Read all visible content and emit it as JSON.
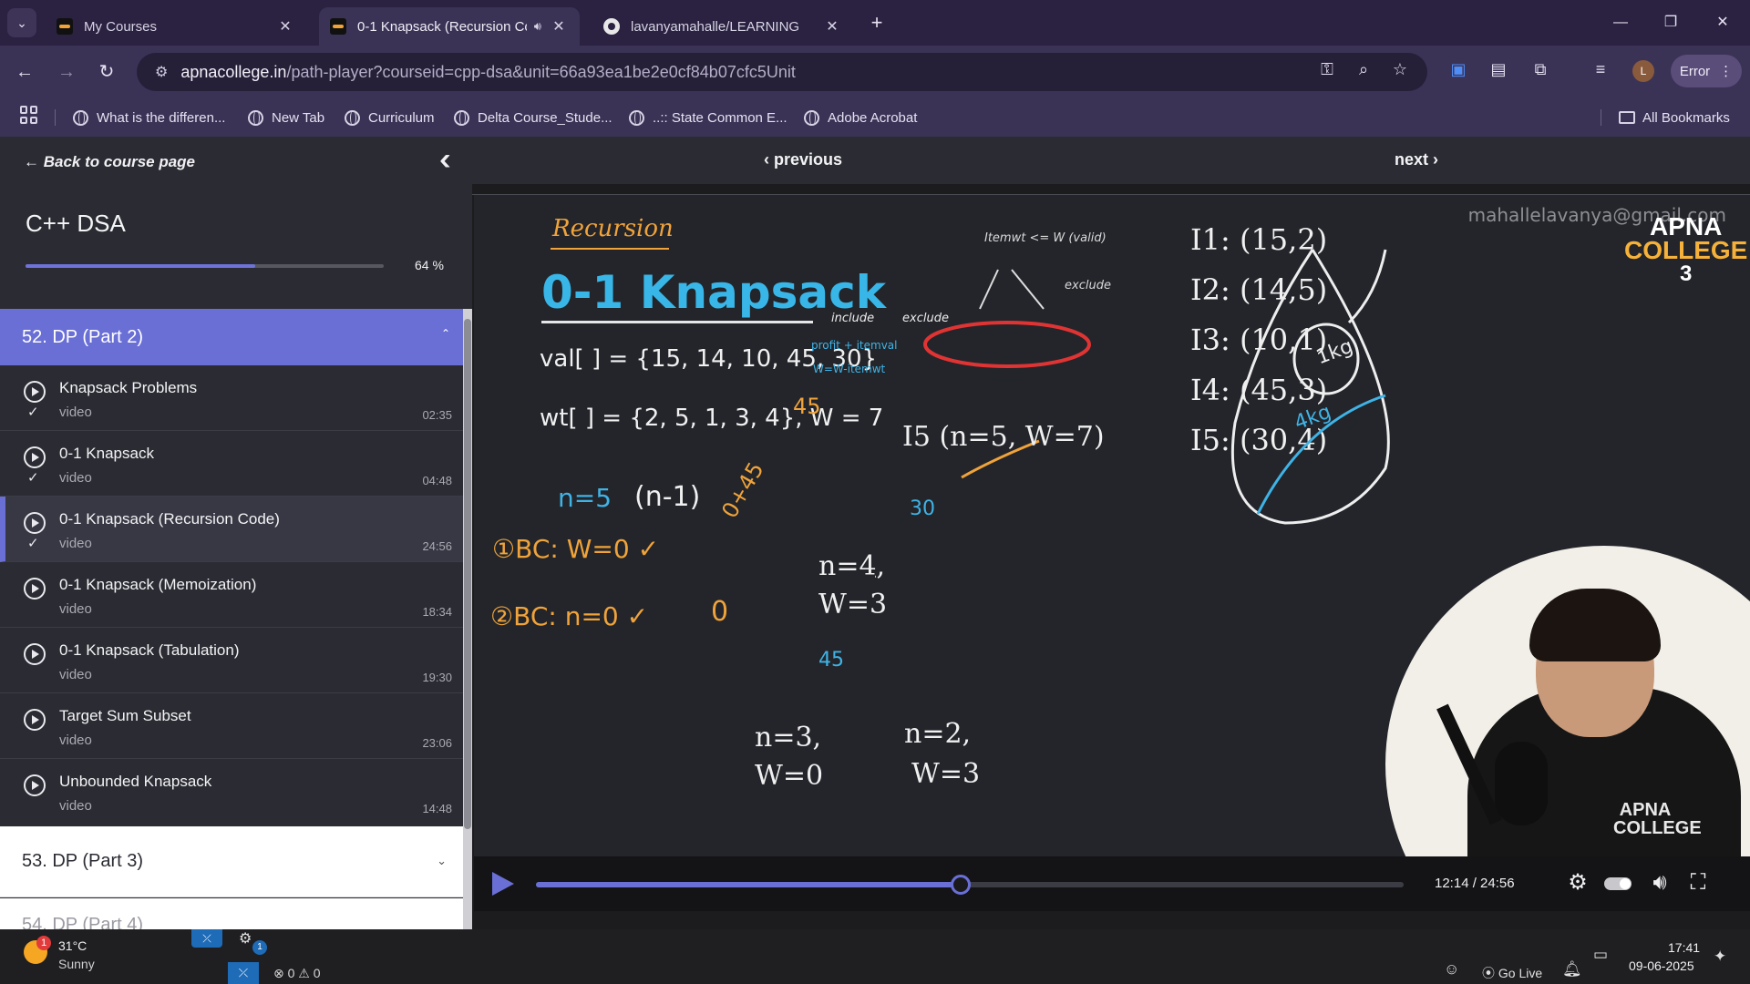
{
  "browser": {
    "tabs": [
      {
        "title": "My Courses"
      },
      {
        "title": "0-1 Knapsack (Recursion Co"
      },
      {
        "title": "lavanyamahalle/LEARNING"
      }
    ],
    "url_host": "apnacollege.in",
    "url_path": "/path-player?courseid=cpp-dsa&unit=66a93ea1be2e0cf84b07cfc5Unit",
    "profile_initial": "L",
    "error_label": "Error",
    "bookmarks": [
      {
        "label": "What is the differen..."
      },
      {
        "label": "New Tab"
      },
      {
        "label": "Curriculum"
      },
      {
        "label": "Delta Course_Stude..."
      },
      {
        "label": "..:: State Common E..."
      },
      {
        "label": "Adobe Acrobat"
      }
    ],
    "all_bookmarks": "All Bookmarks"
  },
  "sidebar": {
    "back_label": "Back to course page",
    "course_title": "C++ DSA",
    "progress": 64,
    "progress_label": "64 %",
    "active_section": "52. DP (Part 2)",
    "lessons": [
      {
        "name": "Knapsack Problems",
        "type": "video",
        "duration": "02:35",
        "done": "✓"
      },
      {
        "name": "0-1 Knapsack",
        "type": "video",
        "duration": "04:48",
        "done": "✓"
      },
      {
        "name": "0-1 Knapsack (Recursion Code)",
        "type": "video",
        "duration": "24:56",
        "done": "✓"
      },
      {
        "name": "0-1 Knapsack (Memoization)",
        "type": "video",
        "duration": "18:34",
        "done": ""
      },
      {
        "name": "0-1 Knapsack (Tabulation)",
        "type": "video",
        "duration": "19:30",
        "done": ""
      },
      {
        "name": "Target Sum Subset",
        "type": "video",
        "duration": "23:06",
        "done": ""
      },
      {
        "name": "Unbounded Knapsack",
        "type": "video",
        "duration": "14:48",
        "done": ""
      }
    ],
    "next_section": "53. DP (Part 3)",
    "peek_section": "54. DP (Part 4)"
  },
  "player": {
    "prev_label": "previous",
    "next_label": "next",
    "current_time": "12:14",
    "total_time": "24:56",
    "time_label": "12:14 / 24:56",
    "played_fraction": 0.489
  },
  "board": {
    "watermark": "mahallelavanya@gmail.com",
    "heading": "Recursion",
    "title": "0-1 Knapsack",
    "val_line": "val[ ] = {15, 14, 10, 45, 30}",
    "wt_line": "wt[ ] = {2, 5, 1, 3, 4}, W = 7",
    "n_line": "n=5",
    "n_minus": "(n-1)",
    "bc1": "①BC: W=0 ✓",
    "bc2": "②BC: n=0 ✓",
    "items": [
      "I1: (15,2)",
      "I2: (14,5)",
      "I3: (10,1)",
      "I4: (45,3)",
      "I5: (30,4)"
    ],
    "root_node": "I5 (n=5, W=7)",
    "mid_node_n": "n=4,",
    "mid_node_w": "W=3",
    "leaf_left_n": "n=3,",
    "leaf_left_w": "W=0",
    "leaf_right_n": "n=2,",
    "leaf_right_w": "W=3",
    "val_30": "30",
    "val_45": "45",
    "val_45_top": "45",
    "zero_label": "0",
    "zero_plus": "0+45",
    "include_label": "include",
    "exclude_label": "exclude",
    "exclude_label_2": "exclude",
    "itemwt_label": "Itemwt <= W (valid)",
    "profit_label": "profit + itemval",
    "w_update_label": "W=W-itemwt",
    "bag_1kg": "1kg",
    "bag_4kg": "4kg",
    "bag_num": "3",
    "logo_top": "APNA",
    "logo_bottom": "COLLEGE",
    "shirt_logo": "APNA COLLEGE"
  },
  "taskbar": {
    "temp": "31°C",
    "condition": "Sunny",
    "weather_badge": "1",
    "gear_badge": "1",
    "problems": "⊗ 0 ⚠ 0",
    "go_live": "Go Live",
    "time": "17:41",
    "date": "09-06-2025"
  }
}
